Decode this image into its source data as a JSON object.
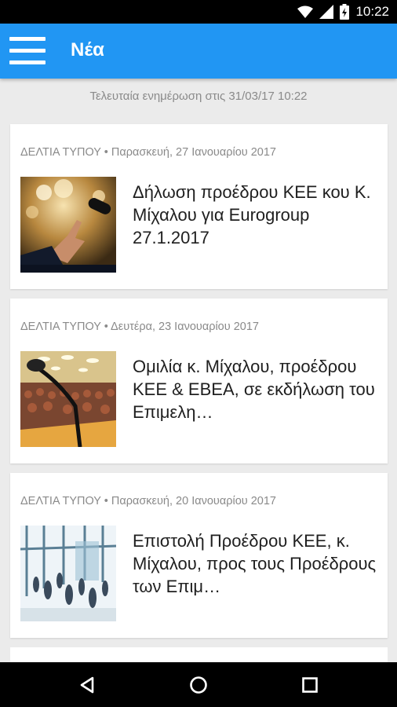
{
  "status_bar": {
    "time": "10:22",
    "icons": [
      "wifi-icon",
      "signal-icon",
      "battery-icon"
    ]
  },
  "app_bar": {
    "title": "Νέα",
    "menu_icon": "hamburger-menu-icon",
    "color": "#2196f3"
  },
  "last_update": "Τελευταία ενημέρωση στις 31/03/17 10:22",
  "articles": [
    {
      "meta": "ΔΕΛΤΙΑ ΤΥΠΟΥ • Παρασκευή, 27 Ιανουαρίου 2017",
      "title": "Δήλωση προέδρου ΚΕΕ κου Κ. Μίχαλου για Eurogroup 27.1.2017",
      "thumbnail": "speaker-microphone-image"
    },
    {
      "meta": "ΔΕΛΤΙΑ ΤΥΠΟΥ • Δευτέρα, 23 Ιανουαρίου 2017",
      "title": "Ομιλία κ. Μίχαλου, προέδρου ΚΕΕ & ΕΒΕΑ, σε εκδήλωση του Επιμελη…",
      "thumbnail": "conference-audience-image"
    },
    {
      "meta": "ΔΕΛΤΙΑ ΤΥΠΟΥ • Παρασκευή, 20 Ιανουαρίου 2017",
      "title": "Επιστολή Προέδρου ΚΕΕ, κ. Μίχαλου, προς τους Προέδρους των Επιμ…",
      "thumbnail": "business-crowd-image"
    }
  ],
  "nav_bar": {
    "buttons": [
      "back-icon",
      "home-icon",
      "recents-icon"
    ]
  }
}
